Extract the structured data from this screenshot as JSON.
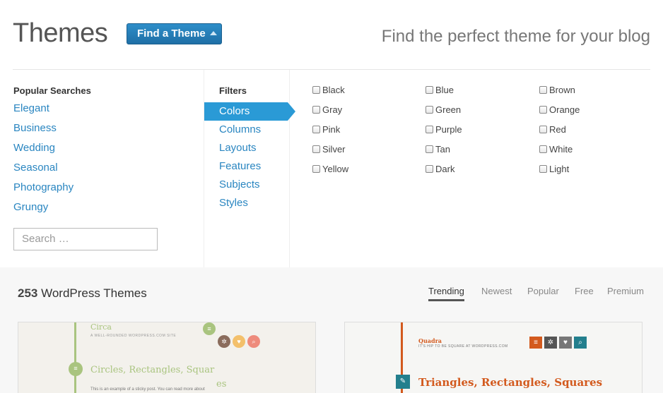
{
  "header": {
    "title": "Themes",
    "find_button": "Find a Theme",
    "tagline": "Find the perfect theme for your blog"
  },
  "popular": {
    "heading": "Popular Searches",
    "items": [
      "Elegant",
      "Business",
      "Wedding",
      "Seasonal",
      "Photography",
      "Grungy"
    ],
    "search_placeholder": "Search …"
  },
  "filters": {
    "heading": "Filters",
    "items": [
      "Colors",
      "Columns",
      "Layouts",
      "Features",
      "Subjects",
      "Styles"
    ],
    "active": "Colors"
  },
  "colors": {
    "items": [
      "Black",
      "Blue",
      "Brown",
      "Gray",
      "Green",
      "Orange",
      "Pink",
      "Purple",
      "Red",
      "Silver",
      "Tan",
      "White",
      "Yellow",
      "Dark",
      "Light"
    ]
  },
  "results": {
    "count": "253",
    "count_label": "WordPress Themes",
    "sort_tabs": [
      "Trending",
      "Newest",
      "Popular",
      "Free",
      "Premium"
    ],
    "active_sort": "Trending"
  },
  "cards": {
    "circa": {
      "name": "Circa",
      "tagline": "A WELL-ROUNDED WORDPRESS.COM SITE",
      "post_title": "Circles, Rectangles, Squar",
      "post_title_wrap": "es",
      "note": "This is an example of a sticky post. You can read more about",
      "accent": "#a9c47f"
    },
    "quadra": {
      "name": "Quadra",
      "tagline": "IT'S HIP TO BE SQUARE AT WORDPRESS.COM",
      "post_title": "Triangles, Rectangles, Squares",
      "accent": "#d35a1e"
    }
  },
  "icons": [
    "menu-icon",
    "gear-icon",
    "heart-icon",
    "search-icon",
    "pin-icon",
    "chevron-up-icon"
  ]
}
